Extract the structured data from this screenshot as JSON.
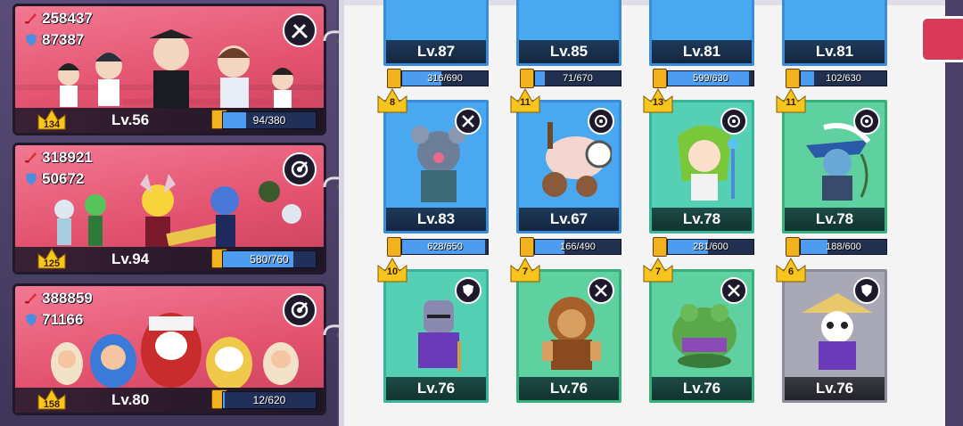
{
  "teams": [
    {
      "atk": "258437",
      "def": "87387",
      "rank": "134",
      "level": "Lv.56",
      "xp": "94/380",
      "xp_frac": 0.25,
      "role": "melee-icon"
    },
    {
      "atk": "318921",
      "def": "50672",
      "rank": "125",
      "level": "Lv.94",
      "xp": "580/760",
      "xp_frac": 0.76,
      "role": "ranged-icon"
    },
    {
      "atk": "388859",
      "def": "71166",
      "rank": "158",
      "level": "Lv.80",
      "xp": "12/620",
      "xp_frac": 0.02,
      "role": "ranged-icon"
    }
  ],
  "heroes_row0": [
    {
      "level": "Lv.87",
      "shards": "316/690",
      "frac": 0.46
    },
    {
      "level": "Lv.85",
      "shards": "71/670",
      "frac": 0.11
    },
    {
      "level": "Lv.81",
      "shards": "599/630",
      "frac": 0.95
    },
    {
      "level": "Lv.81",
      "shards": "102/630",
      "frac": 0.16
    }
  ],
  "heroes_row1": [
    {
      "stars": "8",
      "level": "Lv.83",
      "shards": "628/650",
      "frac": 0.97,
      "role": "melee-icon",
      "name": "rat-hero"
    },
    {
      "stars": "11",
      "level": "Lv.67",
      "shards": "166/490",
      "frac": 0.34,
      "role": "ranged-icon",
      "name": "cannon-hero"
    },
    {
      "stars": "13",
      "level": "Lv.78",
      "shards": "281/600",
      "frac": 0.47,
      "role": "ranged-icon",
      "name": "green-mage-hero"
    },
    {
      "stars": "11",
      "level": "Lv.78",
      "shards": "188/600",
      "frac": 0.31,
      "role": "ranged-icon",
      "name": "archer-hero"
    }
  ],
  "heroes_row2": [
    {
      "stars": "10",
      "level": "Lv.76",
      "role": "shield-icon",
      "name": "knight-hero"
    },
    {
      "stars": "7",
      "level": "Lv.76",
      "role": "melee-icon",
      "name": "lion-hero"
    },
    {
      "stars": "7",
      "level": "Lv.76",
      "role": "melee-icon",
      "name": "frog-hero"
    },
    {
      "stars": "6",
      "level": "Lv.76",
      "role": "shield-icon",
      "name": "panda-hero"
    }
  ]
}
